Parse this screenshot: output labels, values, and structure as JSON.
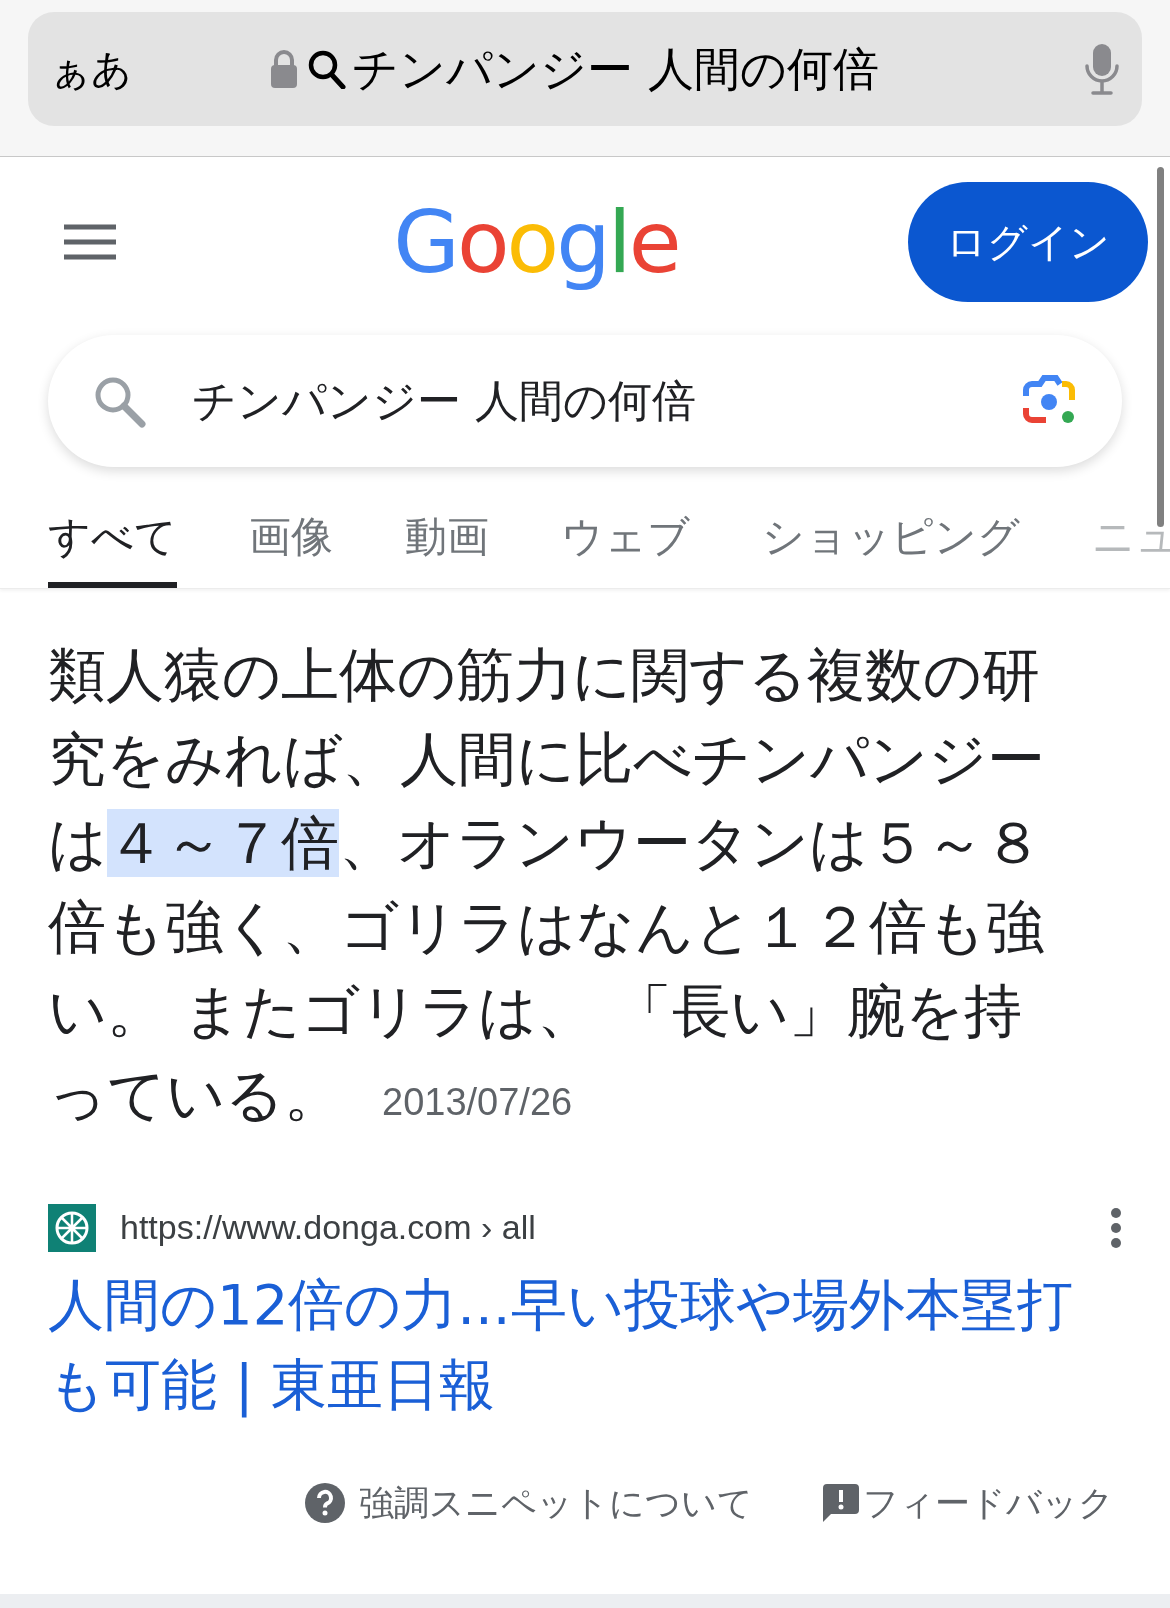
{
  "address_bar": {
    "text_size_button": "ぁあ",
    "query": "チンパンジー 人間の何倍"
  },
  "header": {
    "logo": "Google",
    "login_button": "ログイン"
  },
  "search": {
    "value": "チンパンジー 人間の何倍"
  },
  "tabs": [
    {
      "label": "すべて",
      "selected": true
    },
    {
      "label": "画像",
      "selected": false
    },
    {
      "label": "動画",
      "selected": false
    },
    {
      "label": "ウェブ",
      "selected": false
    },
    {
      "label": "ショッピング",
      "selected": false
    },
    {
      "label": "ニュ",
      "selected": false
    }
  ],
  "snippet": {
    "segments": [
      {
        "text": "類人猿の上体の筋力に関する複数の研究をみれば、人間に比べチンパンジーは",
        "highlighted": false
      },
      {
        "text": "４～７倍",
        "highlighted": true
      },
      {
        "text": "、オランウータンは５～８倍も強く、ゴリラはなんと１２倍も強い。 またゴリラは、 「長い」腕を持っている。",
        "highlighted": false
      }
    ],
    "date": "2013/07/26"
  },
  "result": {
    "url": "https://www.donga.com › all",
    "title": "人間の12倍の力...早い投球や場外本塁打も可能 | 東亜日報"
  },
  "footer": {
    "about": "強調スニペットについて",
    "feedback": "フィードバック"
  }
}
